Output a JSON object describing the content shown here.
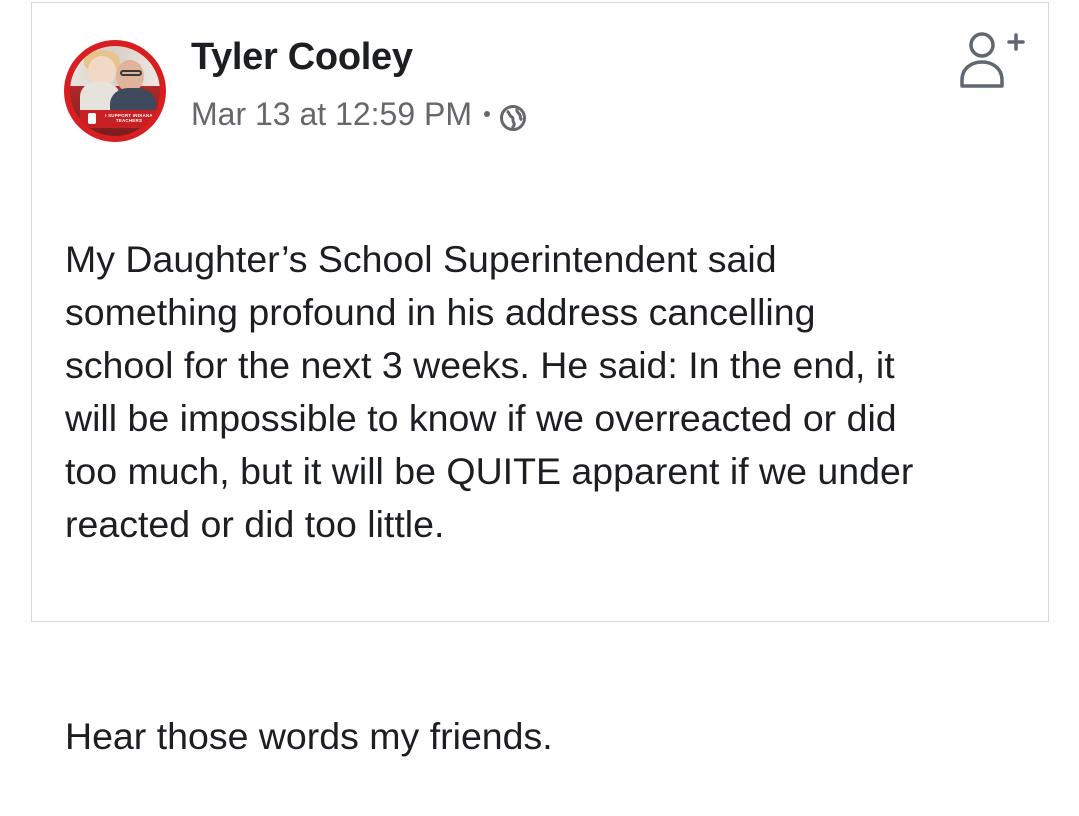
{
  "post": {
    "author": "Tyler Cooley",
    "timestamp": "Mar 13 at 12:59 PM",
    "audience_icon": "globe-icon",
    "avatar_banner": "I SUPPORT INDIANA TEACHERS",
    "action_icon": "add-friend-icon",
    "paragraphs": [
      "My Daughter’s School Superintendent said\nsomething profound in his address cancelling\nschool for the next 3 weeks. He said: In the end, it\nwill be impossible to know if we overreacted or did\ntoo much, but it will be QUITE apparent if we under\nreacted or did too little.",
      "Hear those words my friends."
    ]
  },
  "colors": {
    "text": "#1c1e21",
    "secondary": "#65676b",
    "avatar_ring": "#d91e22",
    "card_border": "#d6d8dc"
  }
}
